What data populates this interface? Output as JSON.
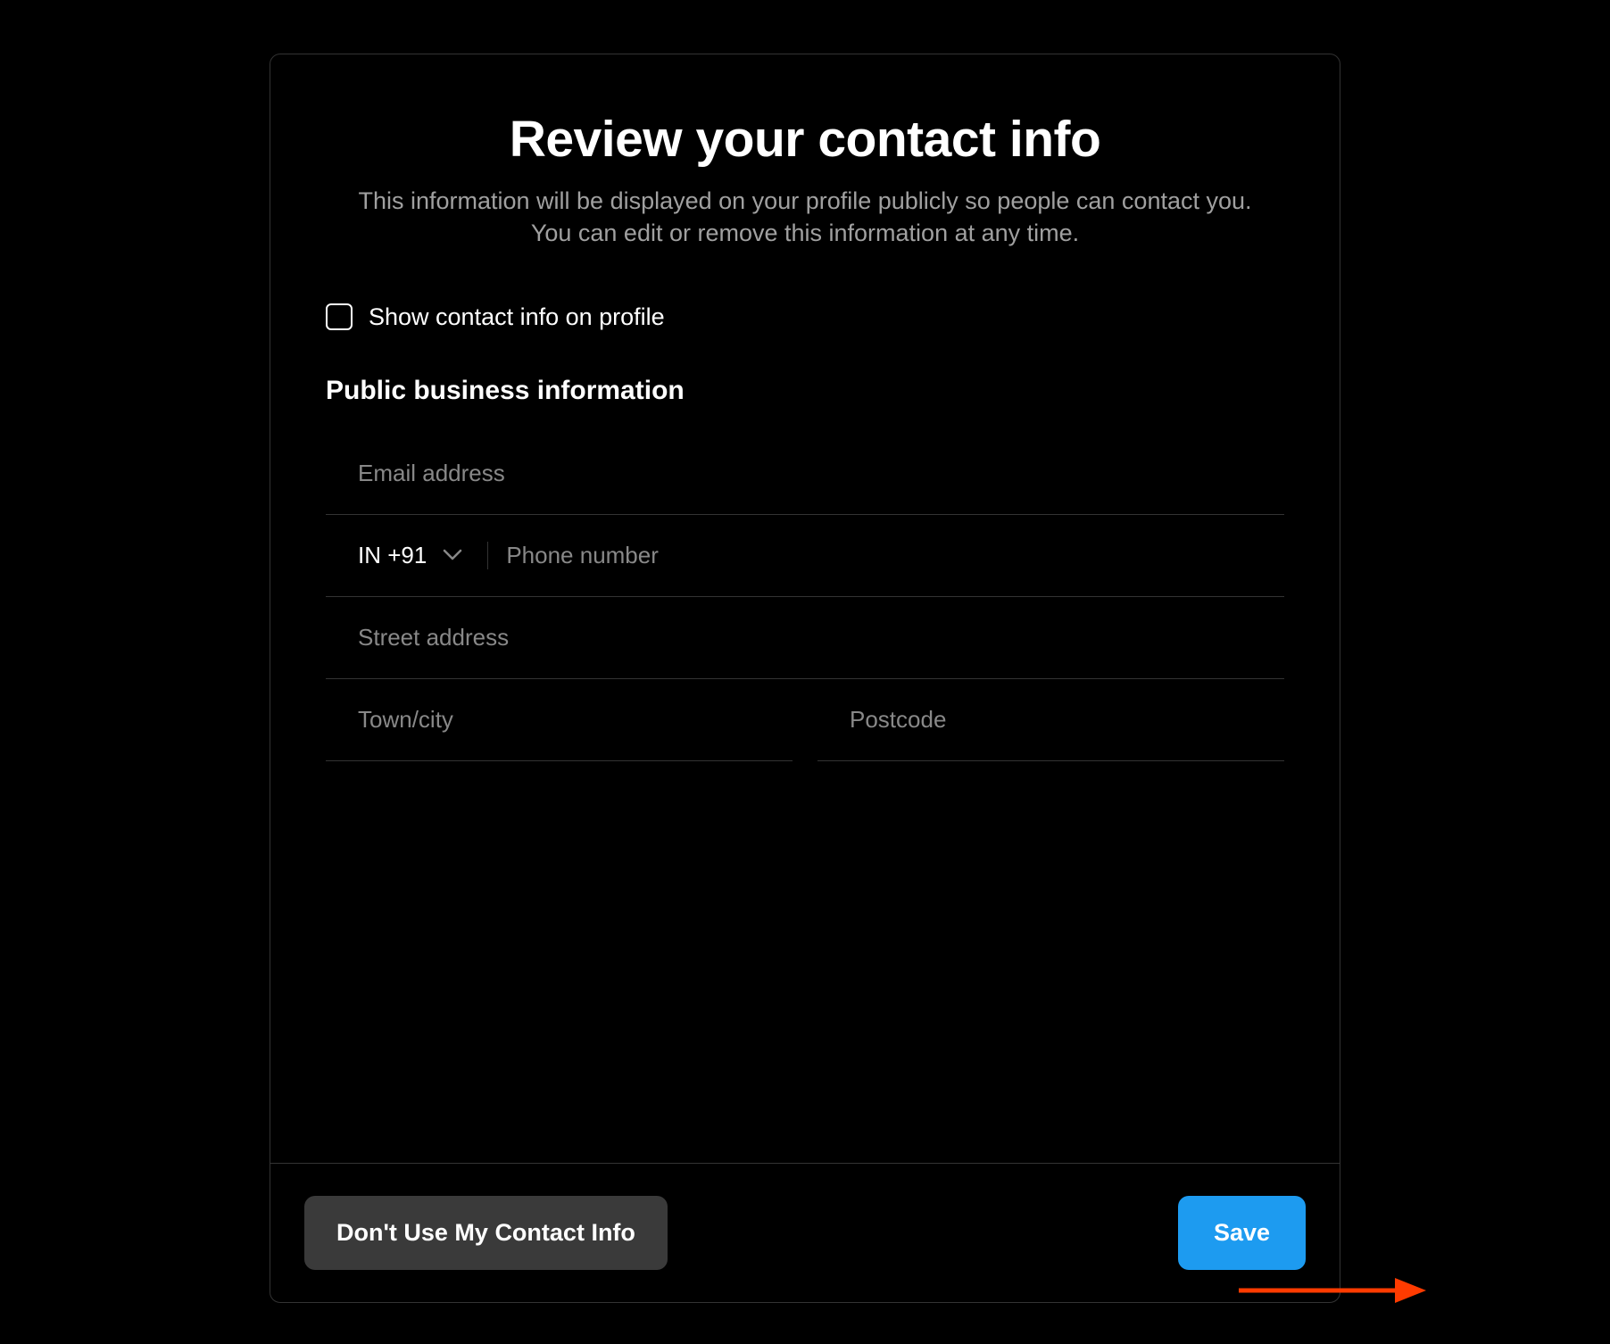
{
  "header": {
    "title": "Review your contact info",
    "subtitle": "This information will be displayed on your profile publicly so people can contact you. You can edit or remove this information at any time."
  },
  "checkbox": {
    "label": "Show contact info on profile",
    "checked": false
  },
  "section": {
    "title": "Public business information"
  },
  "fields": {
    "email": {
      "placeholder": "Email address",
      "value": ""
    },
    "phone": {
      "country": "IN +91",
      "placeholder": "Phone number",
      "value": ""
    },
    "street": {
      "placeholder": "Street address",
      "value": ""
    },
    "town": {
      "placeholder": "Town/city",
      "value": ""
    },
    "postcode": {
      "placeholder": "Postcode",
      "value": ""
    }
  },
  "footer": {
    "dont_use_label": "Don't Use My Contact Info",
    "save_label": "Save"
  },
  "colors": {
    "accent": "#1d9bf0",
    "annotation": "#ff3b00"
  }
}
